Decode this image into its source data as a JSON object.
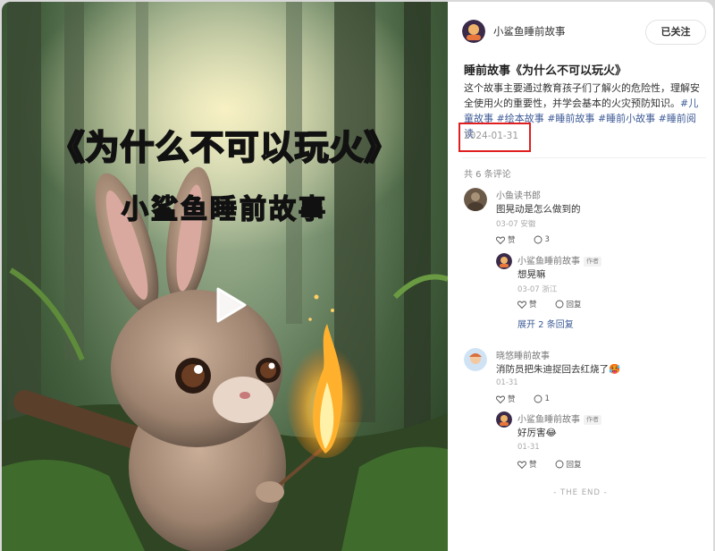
{
  "video": {
    "cover_title": "《为什么不可以玩火》",
    "cover_subtitle": "小鲨鱼睡前故事",
    "play_icon": "play-icon"
  },
  "author": {
    "name": "小鲨鱼睡前故事",
    "follow_label": "已关注"
  },
  "post": {
    "title": "睡前故事《为什么不可以玩火》",
    "desc_text": "这个故事主要通过教育孩子们了解火的危险性，理解安全使用火的重要性，并学会基本的火灾预防知识。",
    "tags": [
      "#儿童故事",
      "#绘本故事",
      "#睡前故事",
      "#睡前小故事",
      "#睡前阅读"
    ],
    "date": "2024-01-31"
  },
  "comments": {
    "count_label": "共 6 条评论",
    "items": [
      {
        "user": "小鱼读书郎",
        "text": "图晃动是怎么做到的",
        "meta": "03-07 安徽",
        "likes_label": "赞",
        "reply_count": "3",
        "reply": {
          "user": "小鲨鱼睡前故事",
          "badge": "作者",
          "text": "想晃嘛",
          "meta": "03-07 浙江",
          "likes_label": "赞",
          "reply_label": "回复"
        },
        "expand_label": "展开 2 条回复"
      },
      {
        "user": "晓悠睡前故事",
        "text": "消防员把朱迪捉回去红烧了🥵",
        "meta": "01-31",
        "likes_label": "赞",
        "reply_count": "1",
        "reply": {
          "user": "小鲨鱼睡前故事",
          "badge": "作者",
          "text": "好厉害😂",
          "meta": "01-31",
          "likes_label": "赞",
          "reply_label": "回复"
        }
      }
    ]
  },
  "end_label": "- THE END -",
  "colors": {
    "tag": "#3d5a96",
    "highlight_box": "#e02020",
    "cover_subtitle": "#f6d86a"
  }
}
